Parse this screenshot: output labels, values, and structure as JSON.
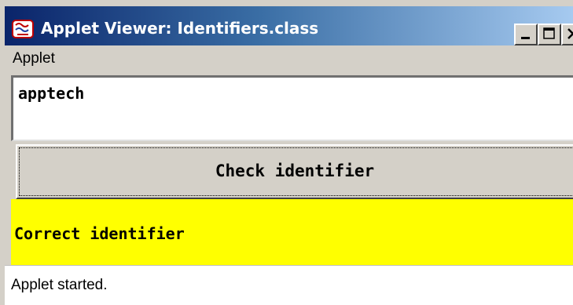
{
  "window": {
    "title": "Applet Viewer: Identifiers.class"
  },
  "menubar": {
    "items": [
      {
        "label": "Applet"
      }
    ]
  },
  "form": {
    "identifier_value": "apptech",
    "check_button_label": "Check identifier",
    "result_text": "Correct identifier",
    "result_background": "#ffff00"
  },
  "status": {
    "text": "Applet started."
  },
  "icons": {
    "app": "java-applet-icon",
    "minimize": "minimize-icon",
    "maximize": "maximize-icon",
    "close": "close-icon"
  },
  "colors": {
    "titlebar_start": "#0a246a",
    "titlebar_end": "#a6caf0",
    "chrome": "#d4d0c8"
  }
}
